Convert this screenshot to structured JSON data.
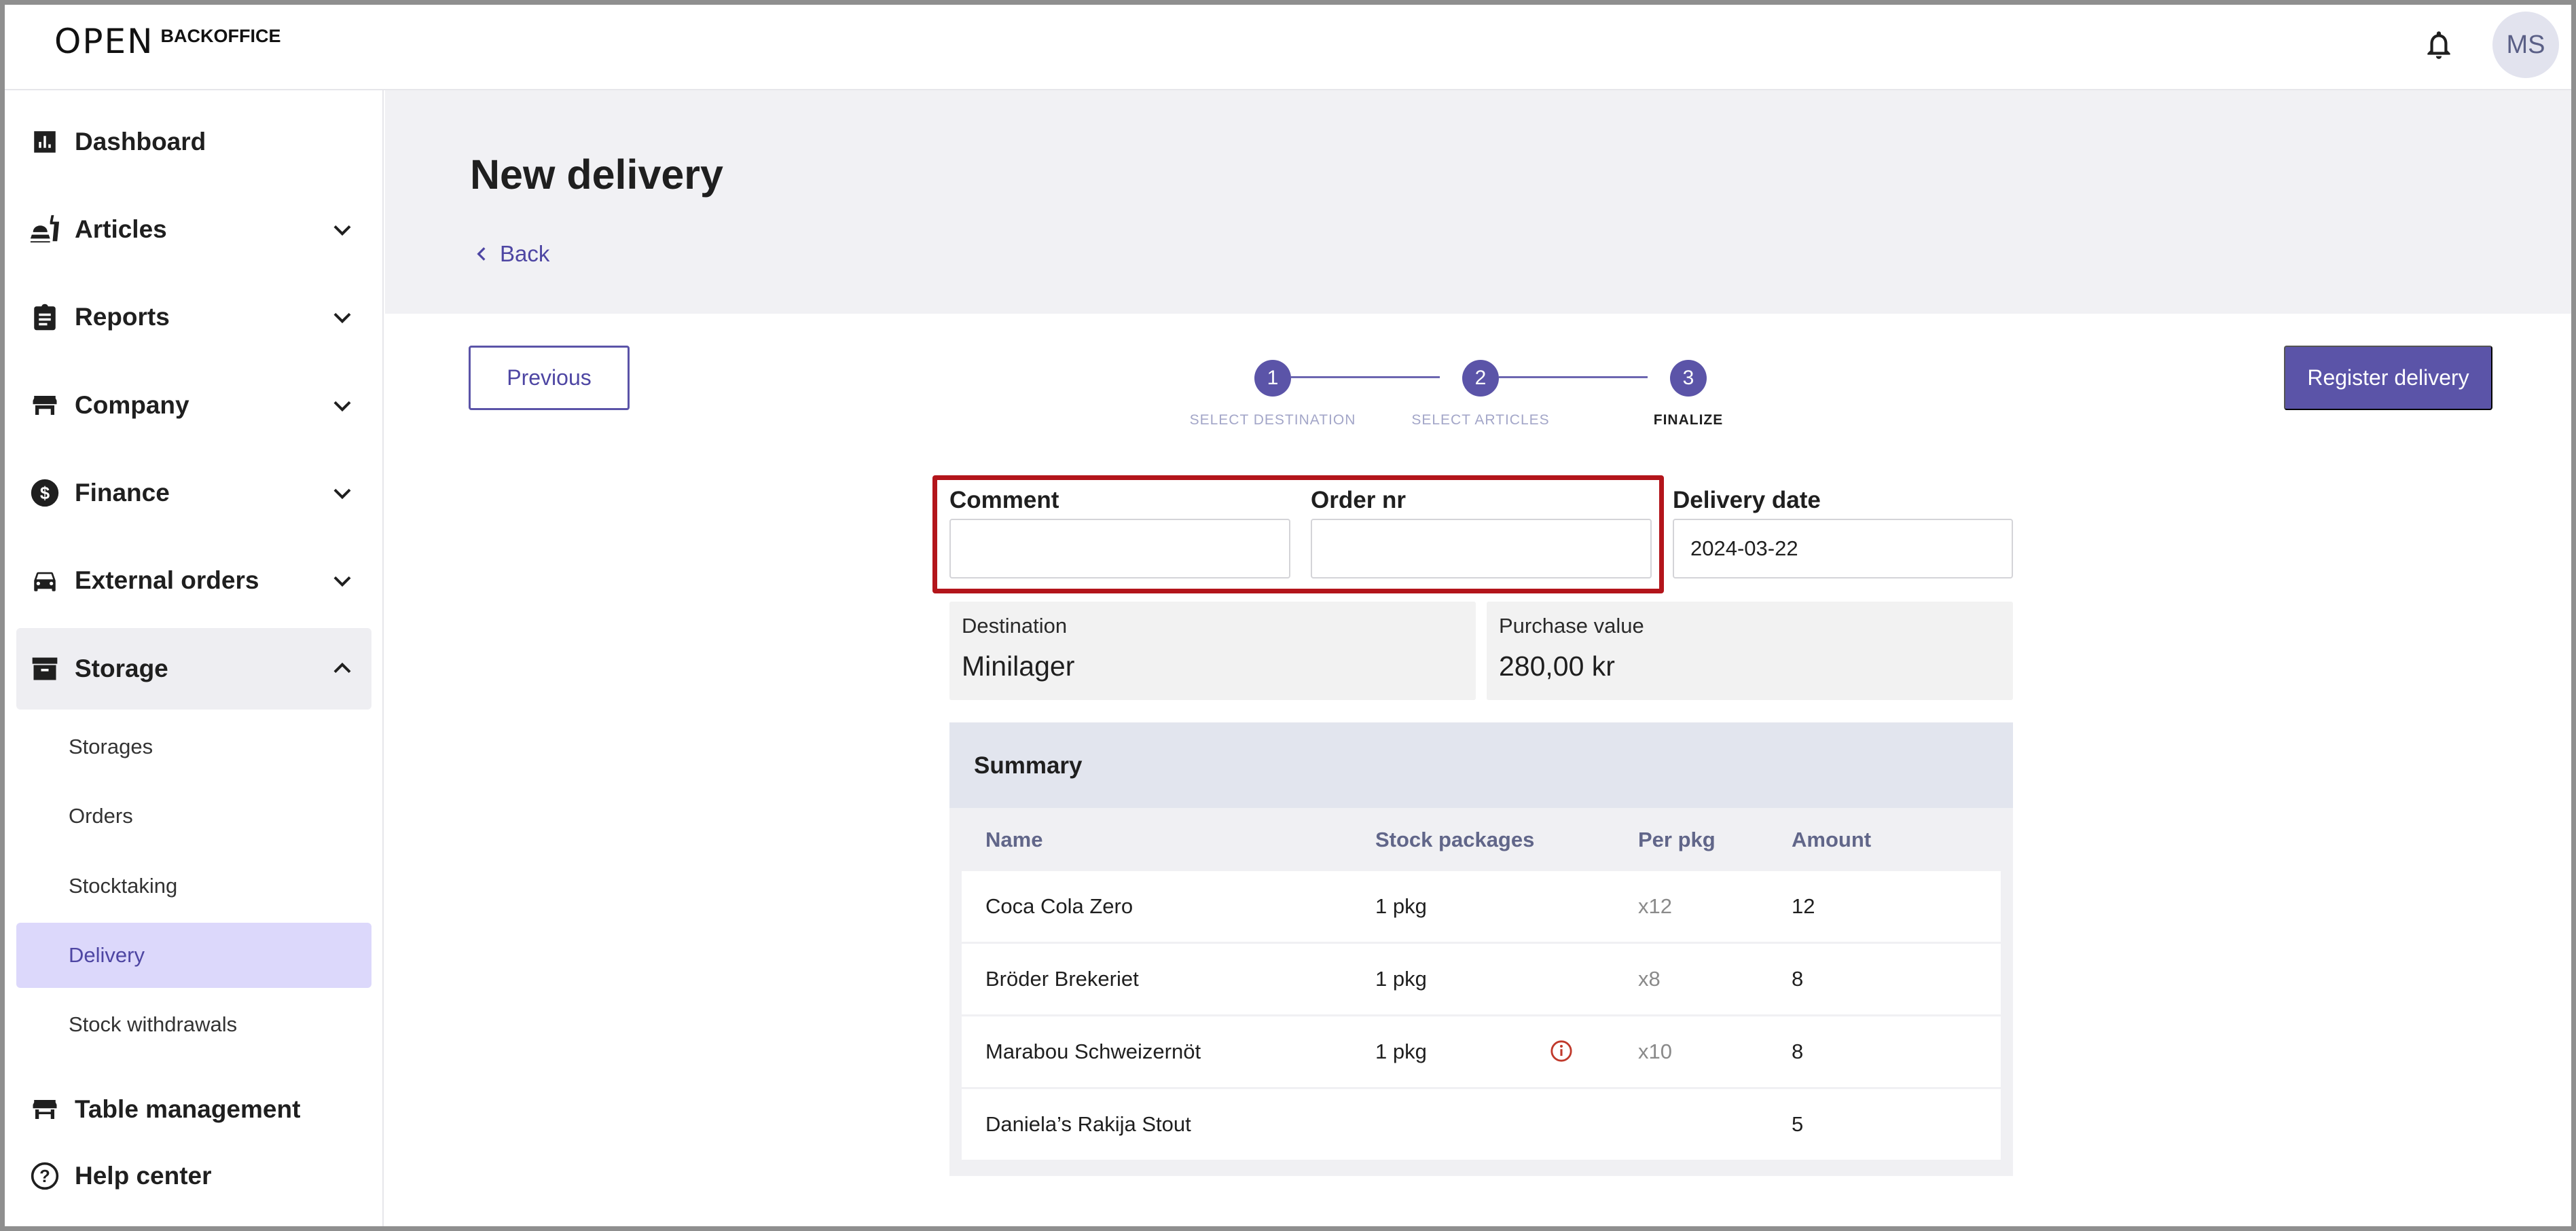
{
  "app": {
    "logo_mark": "OPEN",
    "logo_text": "BACKOFFICE",
    "avatar_initials": "MS"
  },
  "sidebar": {
    "items": [
      {
        "label": "Dashboard",
        "icon": "bar-chart-icon"
      },
      {
        "label": "Articles",
        "icon": "food-icon"
      },
      {
        "label": "Reports",
        "icon": "clipboard-icon"
      },
      {
        "label": "Company",
        "icon": "store-icon"
      },
      {
        "label": "Finance",
        "icon": "dollar-icon"
      },
      {
        "label": "External orders",
        "icon": "car-icon"
      },
      {
        "label": "Storage",
        "icon": "archive-icon"
      }
    ],
    "storage_sub": [
      "Storages",
      "Orders",
      "Stocktaking",
      "Delivery",
      "Stock withdrawals"
    ],
    "table_management": "Table management",
    "help_center": "Help center"
  },
  "page": {
    "title": "New delivery",
    "back_label": "Back",
    "previous_label": "Previous",
    "register_label": "Register delivery"
  },
  "stepper": {
    "steps": [
      {
        "number": "1",
        "label": "SELECT DESTINATION"
      },
      {
        "number": "2",
        "label": "SELECT ARTICLES"
      },
      {
        "number": "3",
        "label": "FINALIZE"
      }
    ],
    "current_step": 3
  },
  "form": {
    "comment_label": "Comment",
    "comment_value": "",
    "order_nr_label": "Order nr",
    "order_nr_value": "",
    "delivery_date_label": "Delivery date",
    "delivery_date_value": "2024-03-22",
    "destination_label": "Destination",
    "destination_value": "Minilager",
    "purchase_value_label": "Purchase value",
    "purchase_value": "280,00 kr"
  },
  "summary": {
    "title": "Summary",
    "columns": [
      "Name",
      "Stock packages",
      "Per pkg",
      "Amount"
    ],
    "rows": [
      {
        "name": "Coca Cola Zero",
        "packages": "1 pkg",
        "per_pkg": "x12",
        "amount": "12",
        "warning": false
      },
      {
        "name": "Bröder Brekeriet",
        "packages": "1 pkg",
        "per_pkg": "x8",
        "amount": "8",
        "warning": false
      },
      {
        "name": "Marabou Schweizernöt",
        "packages": "1 pkg",
        "per_pkg": "x10",
        "amount": "8",
        "warning": true
      },
      {
        "name": "Daniela’s Rakija Stout",
        "packages": "",
        "per_pkg": "",
        "amount": "5",
        "warning": false
      }
    ]
  },
  "colors": {
    "accent": "#5b54a8",
    "highlight_border": "#b3151b",
    "selected_bg": "#dcd8fb",
    "warning": "#c0392b"
  }
}
